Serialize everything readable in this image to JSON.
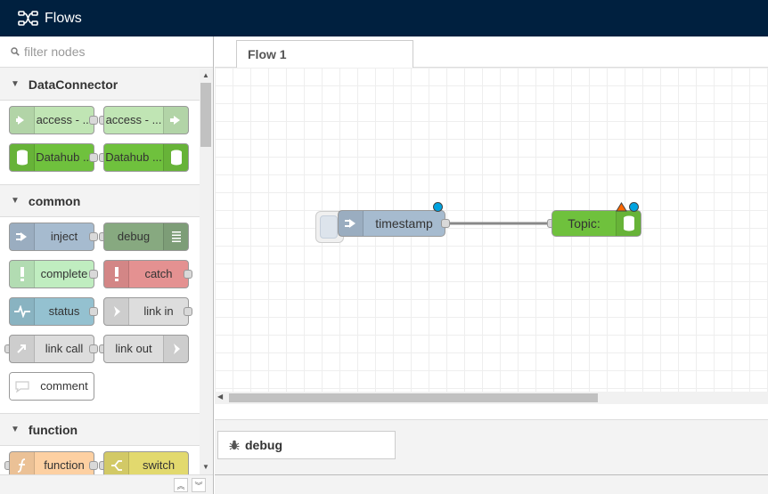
{
  "header": {
    "title": "Flows"
  },
  "palette": {
    "filter_placeholder": "filter nodes",
    "categories": [
      {
        "name": "DataConnector",
        "nodes": [
          {
            "label": "access - ...",
            "color": "#c0e5b4",
            "icon": "arrow-right-icon",
            "icon_side": "left"
          },
          {
            "label": "access - ...",
            "color": "#c0e5b4",
            "icon": "arrow-right-icon",
            "icon_side": "right"
          },
          {
            "label": "Datahub ...",
            "color": "#6fc13d",
            "icon": "database-icon",
            "icon_side": "left"
          },
          {
            "label": "Datahub ...",
            "color": "#6fc13d",
            "icon": "database-icon",
            "icon_side": "right"
          }
        ]
      },
      {
        "name": "common",
        "nodes": [
          {
            "label": "inject",
            "color": "#a6bbcf"
          },
          {
            "label": "debug",
            "color": "#87a980"
          },
          {
            "label": "complete",
            "color": "#c0edc0"
          },
          {
            "label": "catch",
            "color": "#e49191"
          },
          {
            "label": "status",
            "color": "#94c1d0"
          },
          {
            "label": "link in",
            "color": "#dddddd"
          },
          {
            "label": "link call",
            "color": "#dddddd"
          },
          {
            "label": "link out",
            "color": "#dddddd"
          },
          {
            "label": "comment",
            "color": "#ffffff"
          }
        ]
      },
      {
        "name": "function",
        "nodes": [
          {
            "label": "function",
            "color": "#fdd0a2"
          },
          {
            "label": "switch",
            "color": "#e2d96e"
          }
        ]
      }
    ]
  },
  "workspace": {
    "tab_label": "Flow 1",
    "flow_nodes": [
      {
        "label": "timestamp",
        "color": "#a6bbcf"
      },
      {
        "label": "Topic:",
        "color": "#6fc13d"
      }
    ],
    "colors": {
      "wire": "#888888",
      "changed_dot": "#00a3e0",
      "warning": "#ff6600"
    }
  },
  "sidebar": {
    "tab_label": "debug"
  }
}
